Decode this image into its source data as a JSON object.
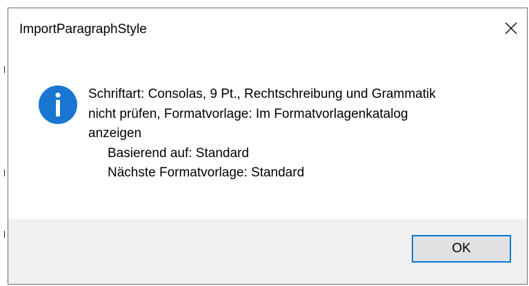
{
  "dialog": {
    "title": "ImportParagraphStyle",
    "close_icon": "close-icon",
    "message_icon": "info-icon",
    "accent_color": "#0078d7",
    "message_lines": [
      "Schriftart: Consolas, 9 Pt., Rechtschreibung und Grammatik",
      "nicht prüfen, Formatvorlage: Im Formatvorlagenkatalog",
      "anzeigen"
    ],
    "detail_lines": [
      "Basierend auf: Standard",
      "Nächste Formatvorlage: Standard"
    ],
    "ok_label": "OK"
  }
}
